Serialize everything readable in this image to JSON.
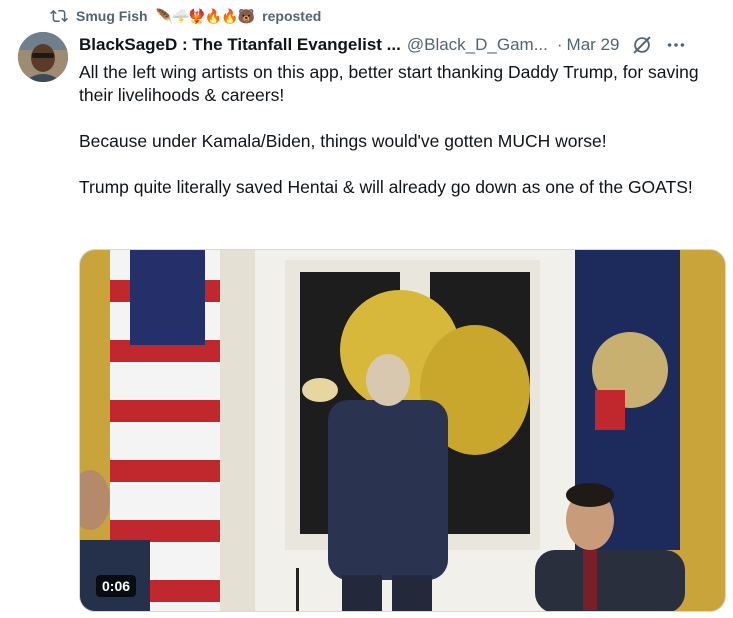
{
  "repost": {
    "user": "Smug Fish",
    "emojis": "🪶🌩️🐦‍🔥🔥🔥🐻",
    "label": "reposted"
  },
  "author": {
    "display_name": "BlackSageD : The Titanfall Evangelist ...",
    "handle": "@Black_D_Gam...",
    "date": "Mar 29"
  },
  "tweet": {
    "paragraphs": [
      "All the left wing artists on this app, better start thanking Daddy Trump, for saving their livelihoods & careers!",
      "Because under Kamala/Biden, things would've gotten MUCH worse!",
      "Trump quite literally saved Hentai & will already go down as one of the GOATS!"
    ]
  },
  "media": {
    "duration": "0:06"
  },
  "icons": {
    "repost": "repost-icon",
    "grok": "grok-icon",
    "more": "more-icon"
  },
  "colors": {
    "text": "#0f1419",
    "secondary": "#536471",
    "border": "#cfd9de"
  }
}
